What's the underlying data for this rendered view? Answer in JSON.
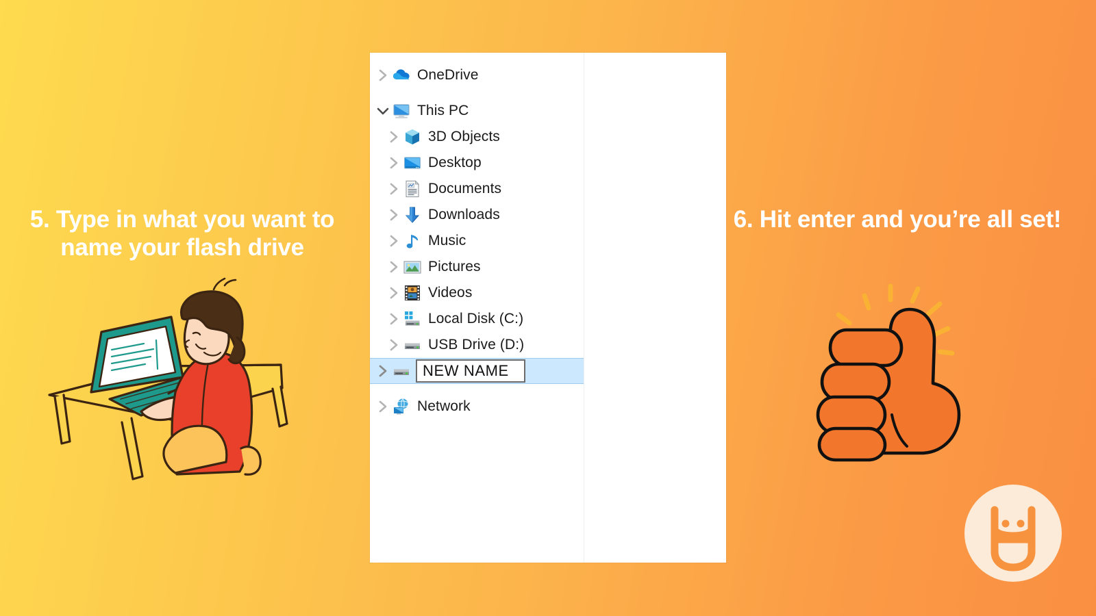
{
  "background": {
    "gradient_from": "#FEDB4F",
    "gradient_to": "#FA8F42"
  },
  "captions": {
    "left": "5. Type in what you want to name your flash drive",
    "right": "6. Hit enter and you’re all set!"
  },
  "illustrations": {
    "left": "person-typing-on-laptop-illustration",
    "right": "thumbs-up-illustration"
  },
  "logo": {
    "name": "usb-smiley-logo",
    "circle_color": "#FCEBD8",
    "mark_color": "#F7923E"
  },
  "explorer": {
    "window_name": "windows-file-explorer-navigation-pane",
    "selection_color": "#CCE8FF",
    "tree": [
      {
        "label": "OneDrive",
        "icon": "onedrive-cloud-icon",
        "indent": 0,
        "expanded": false,
        "selected": false
      },
      {
        "label": "This PC",
        "icon": "this-pc-monitor-icon",
        "indent": 0,
        "expanded": true,
        "selected": false
      },
      {
        "label": "3D Objects",
        "icon": "3d-objects-cube-icon",
        "indent": 1,
        "expanded": false,
        "selected": false
      },
      {
        "label": "Desktop",
        "icon": "desktop-icon",
        "indent": 1,
        "expanded": false,
        "selected": false
      },
      {
        "label": "Documents",
        "icon": "documents-icon",
        "indent": 1,
        "expanded": false,
        "selected": false
      },
      {
        "label": "Downloads",
        "icon": "downloads-arrow-icon",
        "indent": 1,
        "expanded": false,
        "selected": false
      },
      {
        "label": "Music",
        "icon": "music-note-icon",
        "indent": 1,
        "expanded": false,
        "selected": false
      },
      {
        "label": "Pictures",
        "icon": "pictures-icon",
        "indent": 1,
        "expanded": false,
        "selected": false
      },
      {
        "label": "Videos",
        "icon": "videos-film-icon",
        "indent": 1,
        "expanded": false,
        "selected": false
      },
      {
        "label": "Local Disk (C:)",
        "icon": "local-disk-icon",
        "indent": 1,
        "expanded": false,
        "selected": false
      },
      {
        "label": "USB Drive (D:)",
        "icon": "usb-drive-icon",
        "indent": 1,
        "expanded": false,
        "selected": false
      }
    ],
    "rename_row": {
      "icon": "usb-drive-icon",
      "value": "NEW NAME",
      "placeholder": "NEW NAME",
      "selected": true,
      "expanded": false
    },
    "network_row": {
      "label": "Network",
      "icon": "network-icon",
      "indent": 0,
      "expanded": false,
      "selected": false
    }
  }
}
